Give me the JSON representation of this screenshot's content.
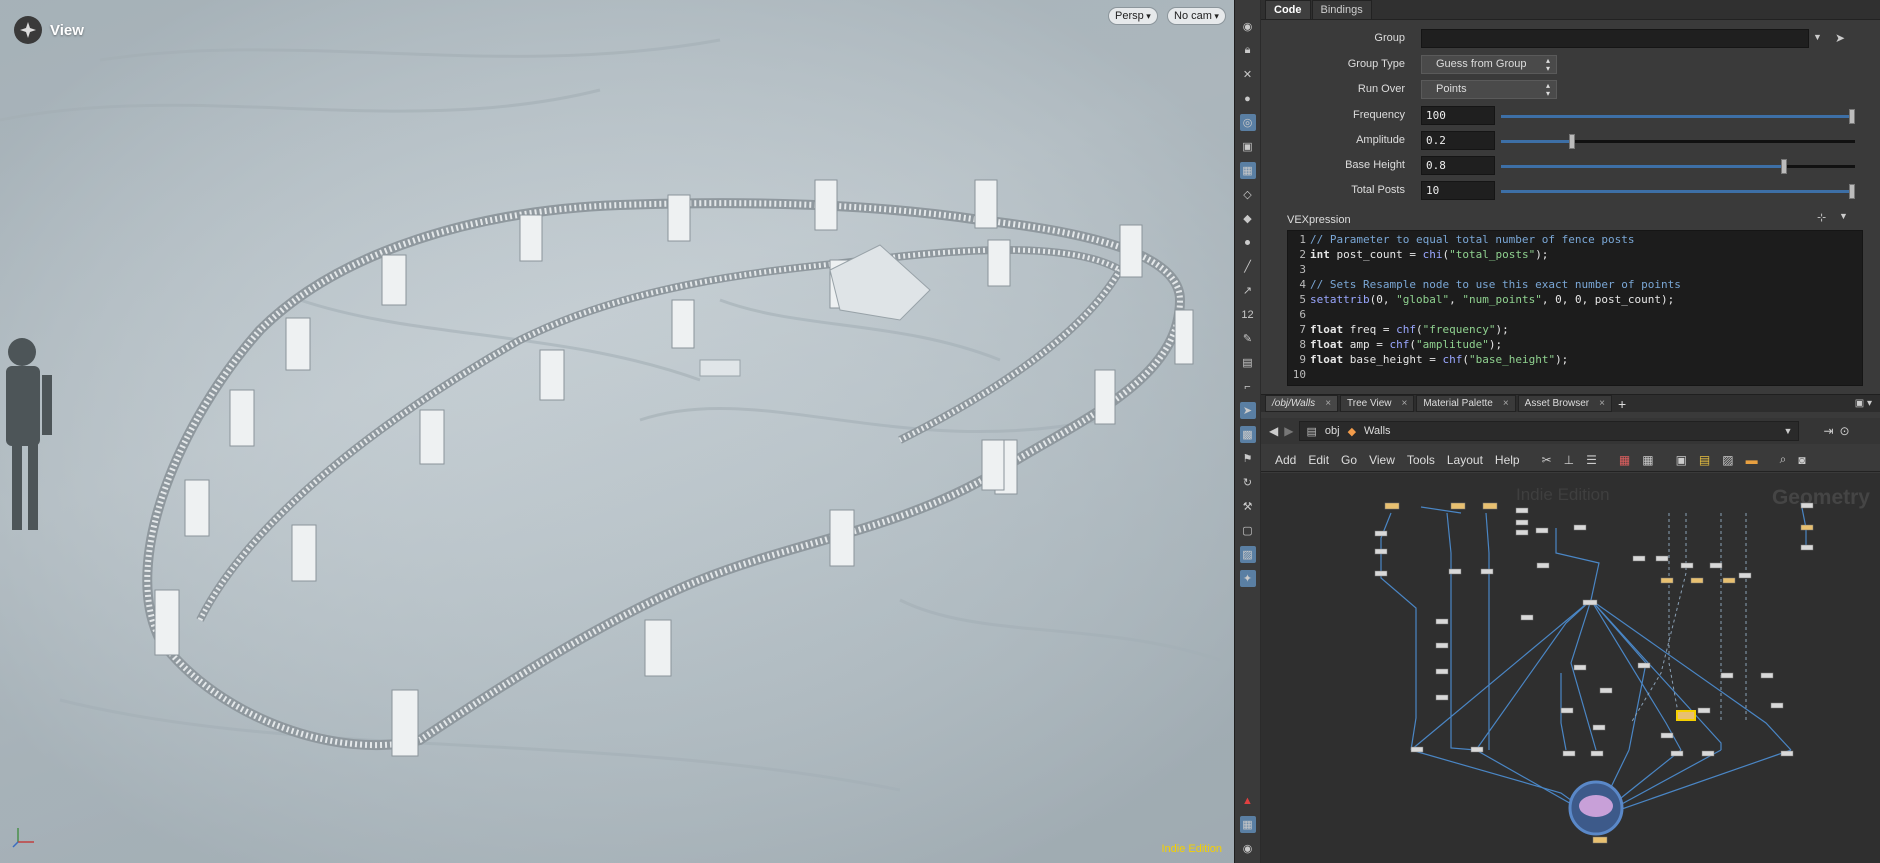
{
  "viewport": {
    "title": "View",
    "persp_label": "Persp",
    "cam_label": "No cam",
    "watermark": "Indie Edition",
    "axis": {
      "y": "y",
      "x": "x",
      "z": "z"
    }
  },
  "toolbar_number": "12",
  "params": {
    "tabs": [
      "Code",
      "Bindings"
    ],
    "group_label": "Group",
    "group_value": "",
    "group_type_label": "Group Type",
    "group_type_value": "Guess from Group",
    "run_over_label": "Run Over",
    "run_over_value": "Points",
    "frequency_label": "Frequency",
    "frequency_value": "100",
    "frequency_fraction": 1.0,
    "amplitude_label": "Amplitude",
    "amplitude_value": "0.2",
    "amplitude_fraction": 0.2,
    "base_height_label": "Base Height",
    "base_height_value": "0.8",
    "base_height_fraction": 0.8,
    "total_posts_label": "Total Posts",
    "total_posts_value": "10",
    "total_posts_fraction": 1.0,
    "vex_label": "VEXpression"
  },
  "code_lines": [
    {
      "n": "1",
      "t": "// Parameter to equal total number of fence posts",
      "k": "com"
    },
    {
      "n": "2",
      "t": "int post_count = chi(\"total_posts\");",
      "k": "code"
    },
    {
      "n": "3",
      "t": "",
      "k": "code"
    },
    {
      "n": "4",
      "t": "// Sets Resample node to use this exact number of points",
      "k": "com"
    },
    {
      "n": "5",
      "t": "setattrib(0, \"global\", \"num_points\", 0, 0, post_count);",
      "k": "code"
    },
    {
      "n": "6",
      "t": "",
      "k": "code"
    },
    {
      "n": "7",
      "t": "float freq = chf(\"frequency\");",
      "k": "code"
    },
    {
      "n": "8",
      "t": "float amp = chf(\"amplitude\");",
      "k": "code"
    },
    {
      "n": "9",
      "t": "float base_height = chf(\"base_height\");",
      "k": "code"
    },
    {
      "n": "10",
      "t": "",
      "k": "code"
    }
  ],
  "net_tabs": [
    "/obj/Walls",
    "Tree View",
    "Material Palette",
    "Asset Browser"
  ],
  "path": {
    "root": "obj",
    "node": "Walls"
  },
  "net_menu": [
    "Add",
    "Edit",
    "Go",
    "View",
    "Tools",
    "Layout",
    "Help"
  ],
  "network_watermark": "Indie Edition",
  "network_context": "Geometry"
}
